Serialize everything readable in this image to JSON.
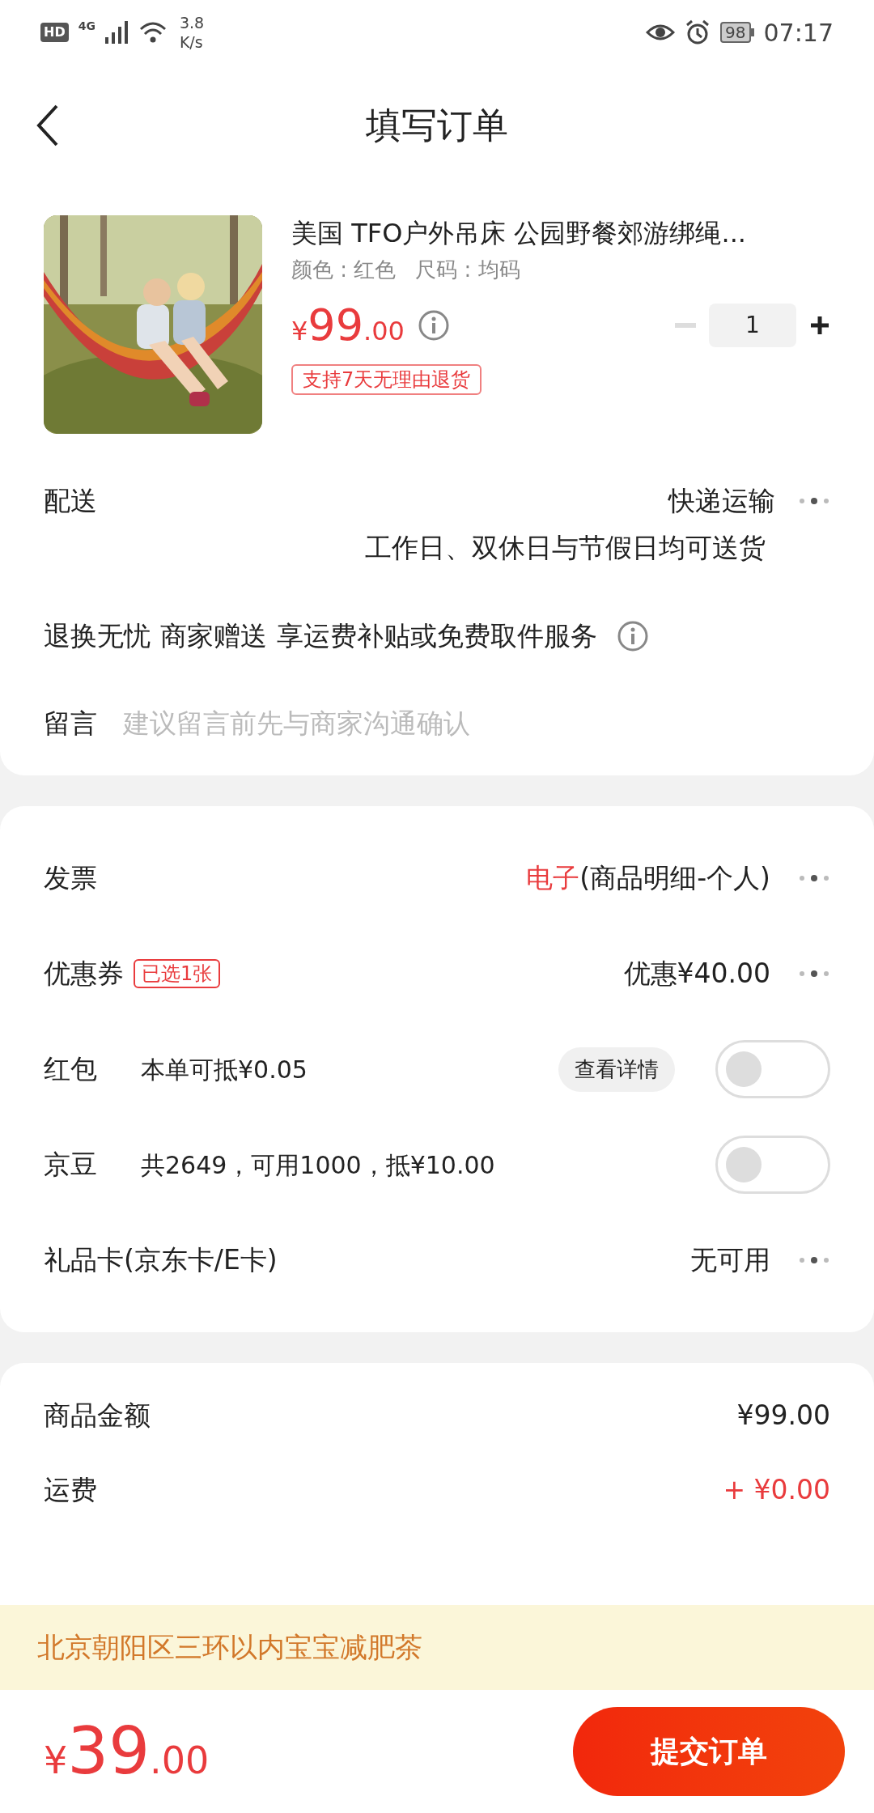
{
  "status_bar": {
    "hd": "HD",
    "network": "4G",
    "speed": "3.8",
    "speed_unit": "K/s",
    "battery": "98",
    "time": "07:17"
  },
  "header": {
    "title": "填写订单"
  },
  "product": {
    "title": "美国 TFO户外吊床 公园野餐郊游绑绳...",
    "specs": [
      "颜色 : 红色",
      "尺码 : 均码"
    ],
    "price": {
      "currency": "¥",
      "integer": "99",
      "decimal": ".00"
    },
    "quantity": "1",
    "minus_disabled": true,
    "badge": "支持7天无理由退货"
  },
  "delivery": {
    "label": "配送",
    "value": "快递运输",
    "note": "工作日、双休日与节假日均可送货"
  },
  "service": [
    "退换无忧",
    "商家赠送",
    "享运费补贴或免费取件服务"
  ],
  "message": {
    "label": "留言",
    "placeholder": "建议留言前先与商家沟通确认"
  },
  "options": [
    {
      "kind": "link",
      "label": "发票",
      "value_accent": "电子",
      "value": "(商品明细-个人)"
    },
    {
      "kind": "link",
      "label": "优惠券",
      "tag": "已选1张",
      "value": "优惠¥40.00"
    },
    {
      "kind": "toggle",
      "label": "红包",
      "detail": "本单可抵¥0.05",
      "button": "查看详情",
      "on": false
    },
    {
      "kind": "toggle",
      "label": "京豆",
      "detail": "共2649，可用1000，抵¥10.00",
      "on": false
    },
    {
      "kind": "link",
      "label": "礼品卡(京东卡/E卡)",
      "value": "无可用"
    }
  ],
  "summary": [
    {
      "kind": "plain",
      "label": "商品金额",
      "value": "¥99.00"
    },
    {
      "kind": "accent",
      "label": "运费",
      "value": "+ ¥0.00"
    }
  ],
  "banner": {
    "text": "北京朝阳区三环以内宝宝减肥茶"
  },
  "footer": {
    "total": {
      "currency": "¥",
      "integer": "39",
      "decimal": ".00"
    },
    "submit": "提交订单"
  }
}
